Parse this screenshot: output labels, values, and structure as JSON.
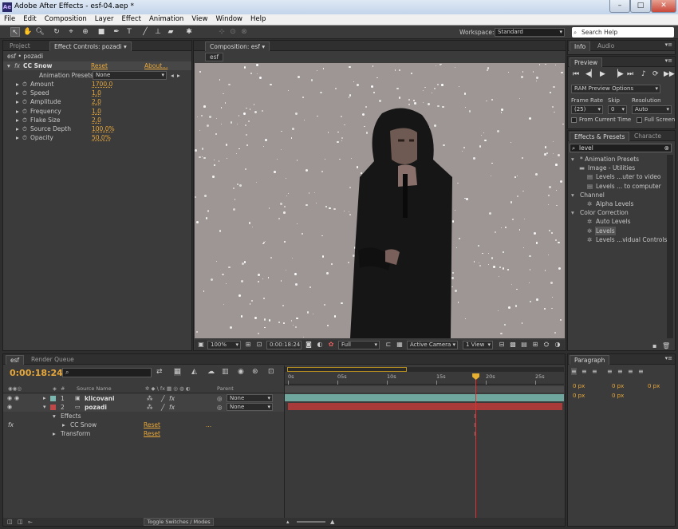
{
  "window": {
    "title": "Adobe After Effects - esf-04.aep *",
    "app_icon": "Ae",
    "min": "–",
    "max": "□",
    "close": "✕"
  },
  "menu": [
    "File",
    "Edit",
    "Composition",
    "Layer",
    "Effect",
    "Animation",
    "View",
    "Window",
    "Help"
  ],
  "toolbar": {
    "workspace_label": "Workspace:",
    "workspace_value": "Standard",
    "search_help": "Search Help"
  },
  "project_panel": {
    "tab_project": "Project",
    "tab_effect_controls": "Effect Controls: pozadi",
    "breadcrumb": "esf • pozadi",
    "effect_name": "CC Snow",
    "reset": "Reset",
    "about": "About...",
    "presets_label": "Animation Presets:",
    "presets_value": "None",
    "params": [
      {
        "name": "Amount",
        "value": "1700,0"
      },
      {
        "name": "Speed",
        "value": "1,0"
      },
      {
        "name": "Amplitude",
        "value": "2,0"
      },
      {
        "name": "Frequency",
        "value": "1,0"
      },
      {
        "name": "Flake Size",
        "value": "2,0"
      },
      {
        "name": "Source Depth",
        "value": "100,0%"
      },
      {
        "name": "Opacity",
        "value": "50,0%"
      }
    ]
  },
  "composition": {
    "tab": "Composition: esf",
    "sub_tab": "esf",
    "zoom": "100%",
    "timecode": "0:00:18:24",
    "quality": "Full",
    "camera": "Active Camera",
    "view": "1 View",
    "bg_color": "#9e9695"
  },
  "info_panel": {
    "tab_info": "Info",
    "tab_audio": "Audio"
  },
  "preview_panel": {
    "tab": "Preview",
    "ram_options": "RAM Preview Options",
    "frame_rate_label": "Frame Rate",
    "skip_label": "Skip",
    "resolution_label": "Resolution",
    "frame_rate_value": "(25)",
    "skip_value": "0",
    "resolution_value": "Auto",
    "from_current": "From Current Time",
    "full_screen": "Full Screen"
  },
  "effects_presets": {
    "tab": "Effects & Presets",
    "tab2": "Characte",
    "search_value": "level",
    "tree": [
      {
        "label": "* Animation Presets",
        "level": 0,
        "icon": "triangle-down-icon"
      },
      {
        "label": "Image - Utilities",
        "level": 1,
        "icon": "folder-icon"
      },
      {
        "label": "Levels ...uter to video",
        "level": 2,
        "icon": "preset-icon"
      },
      {
        "label": "Levels ... to computer",
        "level": 2,
        "icon": "preset-icon"
      },
      {
        "label": "Channel",
        "level": 0,
        "icon": "triangle-down-icon"
      },
      {
        "label": "Alpha Levels",
        "level": 2,
        "icon": "effect-icon"
      },
      {
        "label": "Color Correction",
        "level": 0,
        "icon": "triangle-down-icon"
      },
      {
        "label": "Auto Levels",
        "level": 2,
        "icon": "effect-icon"
      },
      {
        "label": "Levels",
        "level": 2,
        "icon": "effect-icon",
        "selected": true
      },
      {
        "label": "Levels ...vidual Controls)",
        "level": 2,
        "icon": "effect-icon"
      }
    ]
  },
  "paragraph_panel": {
    "tab": "Paragraph",
    "fields": [
      "0 px",
      "0 px",
      "0 px",
      "0 px",
      "0 px"
    ]
  },
  "timeline": {
    "tab_comp": "esf",
    "tab_render": "Render Queue",
    "timecode": "0:00:18:24",
    "col_num": "#",
    "col_source": "Source Name",
    "col_parent": "Parent",
    "ruler": [
      "0s",
      "05s",
      "10s",
      "15s",
      "20s",
      "25s"
    ],
    "playhead_seconds": 18.96,
    "layers": [
      {
        "num": "1",
        "name": "klicovani",
        "parent": "None",
        "color": "#7ab8b0",
        "bar_color": "#6fa69e"
      },
      {
        "num": "2",
        "name": "pozadi",
        "parent": "None",
        "color": "#c14848",
        "bar_color": "#a83a3a"
      }
    ],
    "sub_rows": [
      {
        "label": "Effects",
        "indent": 1
      },
      {
        "label": "CC Snow",
        "indent": 2,
        "reset": "Reset",
        "extra": "..."
      },
      {
        "label": "Transform",
        "indent": 1,
        "reset": "Reset"
      }
    ],
    "toggle_label": "Toggle Switches / Modes"
  }
}
